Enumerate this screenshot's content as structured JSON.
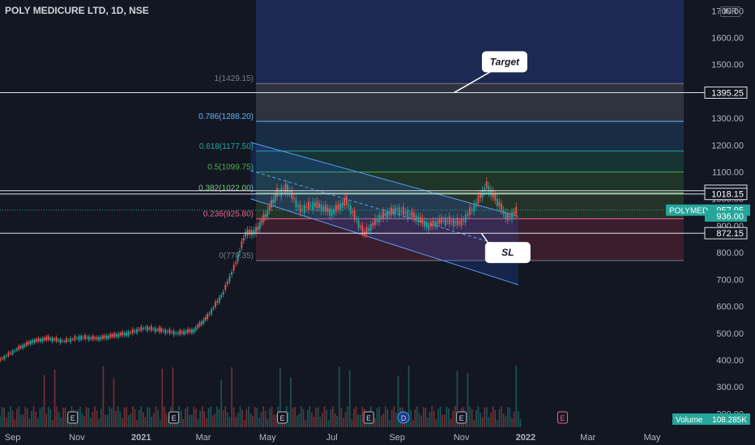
{
  "title": "POLY MEDICURE LTD, 1D, NSE",
  "currency": "INR",
  "colors": {
    "background": "#131722",
    "axis_text": "#b2b5be",
    "up": "#26a69a",
    "down": "#ef5350",
    "white_line": "#e0e3eb"
  },
  "chart_data": {
    "type": "candlestick",
    "y_axis": {
      "ticks": [
        1700,
        1600,
        1500,
        1400,
        1300,
        1200,
        1100,
        1000,
        900,
        800,
        700,
        600,
        500,
        400,
        300,
        200
      ],
      "tick_labels": [
        "1700.00",
        "1600.00",
        "1500.00",
        "1400.00",
        "1300.00",
        "1200.00",
        "1100.00",
        "1000.00",
        "900.00",
        "800.00",
        "700.00",
        "600.00",
        "500.00",
        "400.00",
        "300.00",
        "200.00"
      ],
      "ylim": [
        150,
        1740
      ]
    },
    "x_axis": {
      "tick_labels": [
        "Sep",
        "Nov",
        "2021",
        "Mar",
        "May",
        "Jul",
        "Sep",
        "Nov",
        "2022",
        "Mar",
        "May"
      ],
      "xlim": [
        "2020-08-20",
        "2022-06-20"
      ],
      "tick_dates": [
        "2020-09-01",
        "2020-11-01",
        "2021-01-01",
        "2021-03-01",
        "2021-05-01",
        "2021-07-01",
        "2021-09-01",
        "2021-11-01",
        "2022-01-01",
        "2022-03-01",
        "2022-05-01"
      ]
    },
    "fibonacci": {
      "start_date": "2021-04-20",
      "end_date": "2022-05-31",
      "levels": [
        {
          "ratio": "1",
          "price": 1429.15,
          "label": "1(1429.15)",
          "color": "#787b86"
        },
        {
          "ratio": "0.786",
          "price": 1288.2,
          "label": "0.786(1288.20)",
          "color": "#64b5f6"
        },
        {
          "ratio": "0.618",
          "price": 1177.5,
          "label": "0.618(1177.50)",
          "color": "#26a69a"
        },
        {
          "ratio": "0.5",
          "price": 1099.75,
          "label": "0.5(1099.75)",
          "color": "#4caf50"
        },
        {
          "ratio": "0.382",
          "price": 1022.0,
          "label": "0.382(1022.00)",
          "color": "#81c784"
        },
        {
          "ratio": "0.236",
          "price": 925.8,
          "label": "0.236(925.80)",
          "color": "#f06292"
        },
        {
          "ratio": "0",
          "price": 770.35,
          "label": "0(770.35)",
          "color": "#787b86"
        }
      ],
      "extension_top": 1740
    },
    "horizontal_lines": [
      {
        "price": 1395.25,
        "label": "1395.25"
      },
      {
        "price": 1030.0,
        "label": "1030.00"
      },
      {
        "price": 1018.15,
        "label": "1018.15"
      },
      {
        "price": 872.15,
        "label": "872.15"
      }
    ],
    "current_price": {
      "symbol": "POLYMED",
      "price": 957.95,
      "label": "957.95"
    },
    "marker_price": {
      "price": 936.0,
      "label": "936.00"
    },
    "channel": {
      "upper_start": {
        "date": "2021-04-15",
        "price": 1210
      },
      "upper_end": {
        "date": "2021-12-25",
        "price": 935
      },
      "lower_start": {
        "date": "2021-04-15",
        "price": 1000
      },
      "lower_end": {
        "date": "2021-12-25",
        "price": 680
      }
    },
    "annotations": [
      {
        "text": "Target",
        "date": "2021-12-12",
        "price": 1510,
        "pointer_date": "2021-10-25",
        "pointer_price": 1395
      },
      {
        "text": "SL",
        "date": "2021-12-15",
        "price": 800,
        "pointer_date": "2021-11-20",
        "pointer_price": 872
      }
    ],
    "events": [
      {
        "date": "2020-10-28",
        "label": "E"
      },
      {
        "date": "2021-02-01",
        "label": "E"
      },
      {
        "date": "2021-05-15",
        "label": "E"
      },
      {
        "date": "2021-08-05",
        "label": "E"
      },
      {
        "date": "2021-09-07",
        "label": "D"
      },
      {
        "date": "2021-11-01",
        "label": "E"
      },
      {
        "date": "2022-02-05",
        "label": "E"
      }
    ],
    "volume_label": {
      "name": "Volume",
      "value": "108.285K"
    },
    "price_series": [
      [
        "2020-08-20",
        400
      ],
      [
        "2020-09-05",
        440
      ],
      [
        "2020-09-20",
        470
      ],
      [
        "2020-10-05",
        480
      ],
      [
        "2020-10-20",
        470
      ],
      [
        "2020-11-05",
        485
      ],
      [
        "2020-11-20",
        480
      ],
      [
        "2020-12-05",
        490
      ],
      [
        "2020-12-20",
        500
      ],
      [
        "2021-01-05",
        520
      ],
      [
        "2021-01-20",
        510
      ],
      [
        "2021-02-05",
        500
      ],
      [
        "2021-02-20",
        510
      ],
      [
        "2021-03-05",
        560
      ],
      [
        "2021-03-20",
        650
      ],
      [
        "2021-04-01",
        760
      ],
      [
        "2021-04-10",
        870
      ],
      [
        "2021-04-20",
        880
      ],
      [
        "2021-05-01",
        950
      ],
      [
        "2021-05-10",
        1020
      ],
      [
        "2021-05-20",
        1040
      ],
      [
        "2021-06-01",
        960
      ],
      [
        "2021-06-15",
        980
      ],
      [
        "2021-07-01",
        950
      ],
      [
        "2021-07-15",
        990
      ],
      [
        "2021-08-01",
        870
      ],
      [
        "2021-08-15",
        930
      ],
      [
        "2021-09-01",
        960
      ],
      [
        "2021-09-15",
        940
      ],
      [
        "2021-10-01",
        900
      ],
      [
        "2021-10-15",
        920
      ],
      [
        "2021-11-01",
        910
      ],
      [
        "2021-11-15",
        980
      ],
      [
        "2021-11-25",
        1050
      ],
      [
        "2021-12-05",
        990
      ],
      [
        "2021-12-15",
        930
      ],
      [
        "2021-12-25",
        957.95
      ]
    ]
  }
}
